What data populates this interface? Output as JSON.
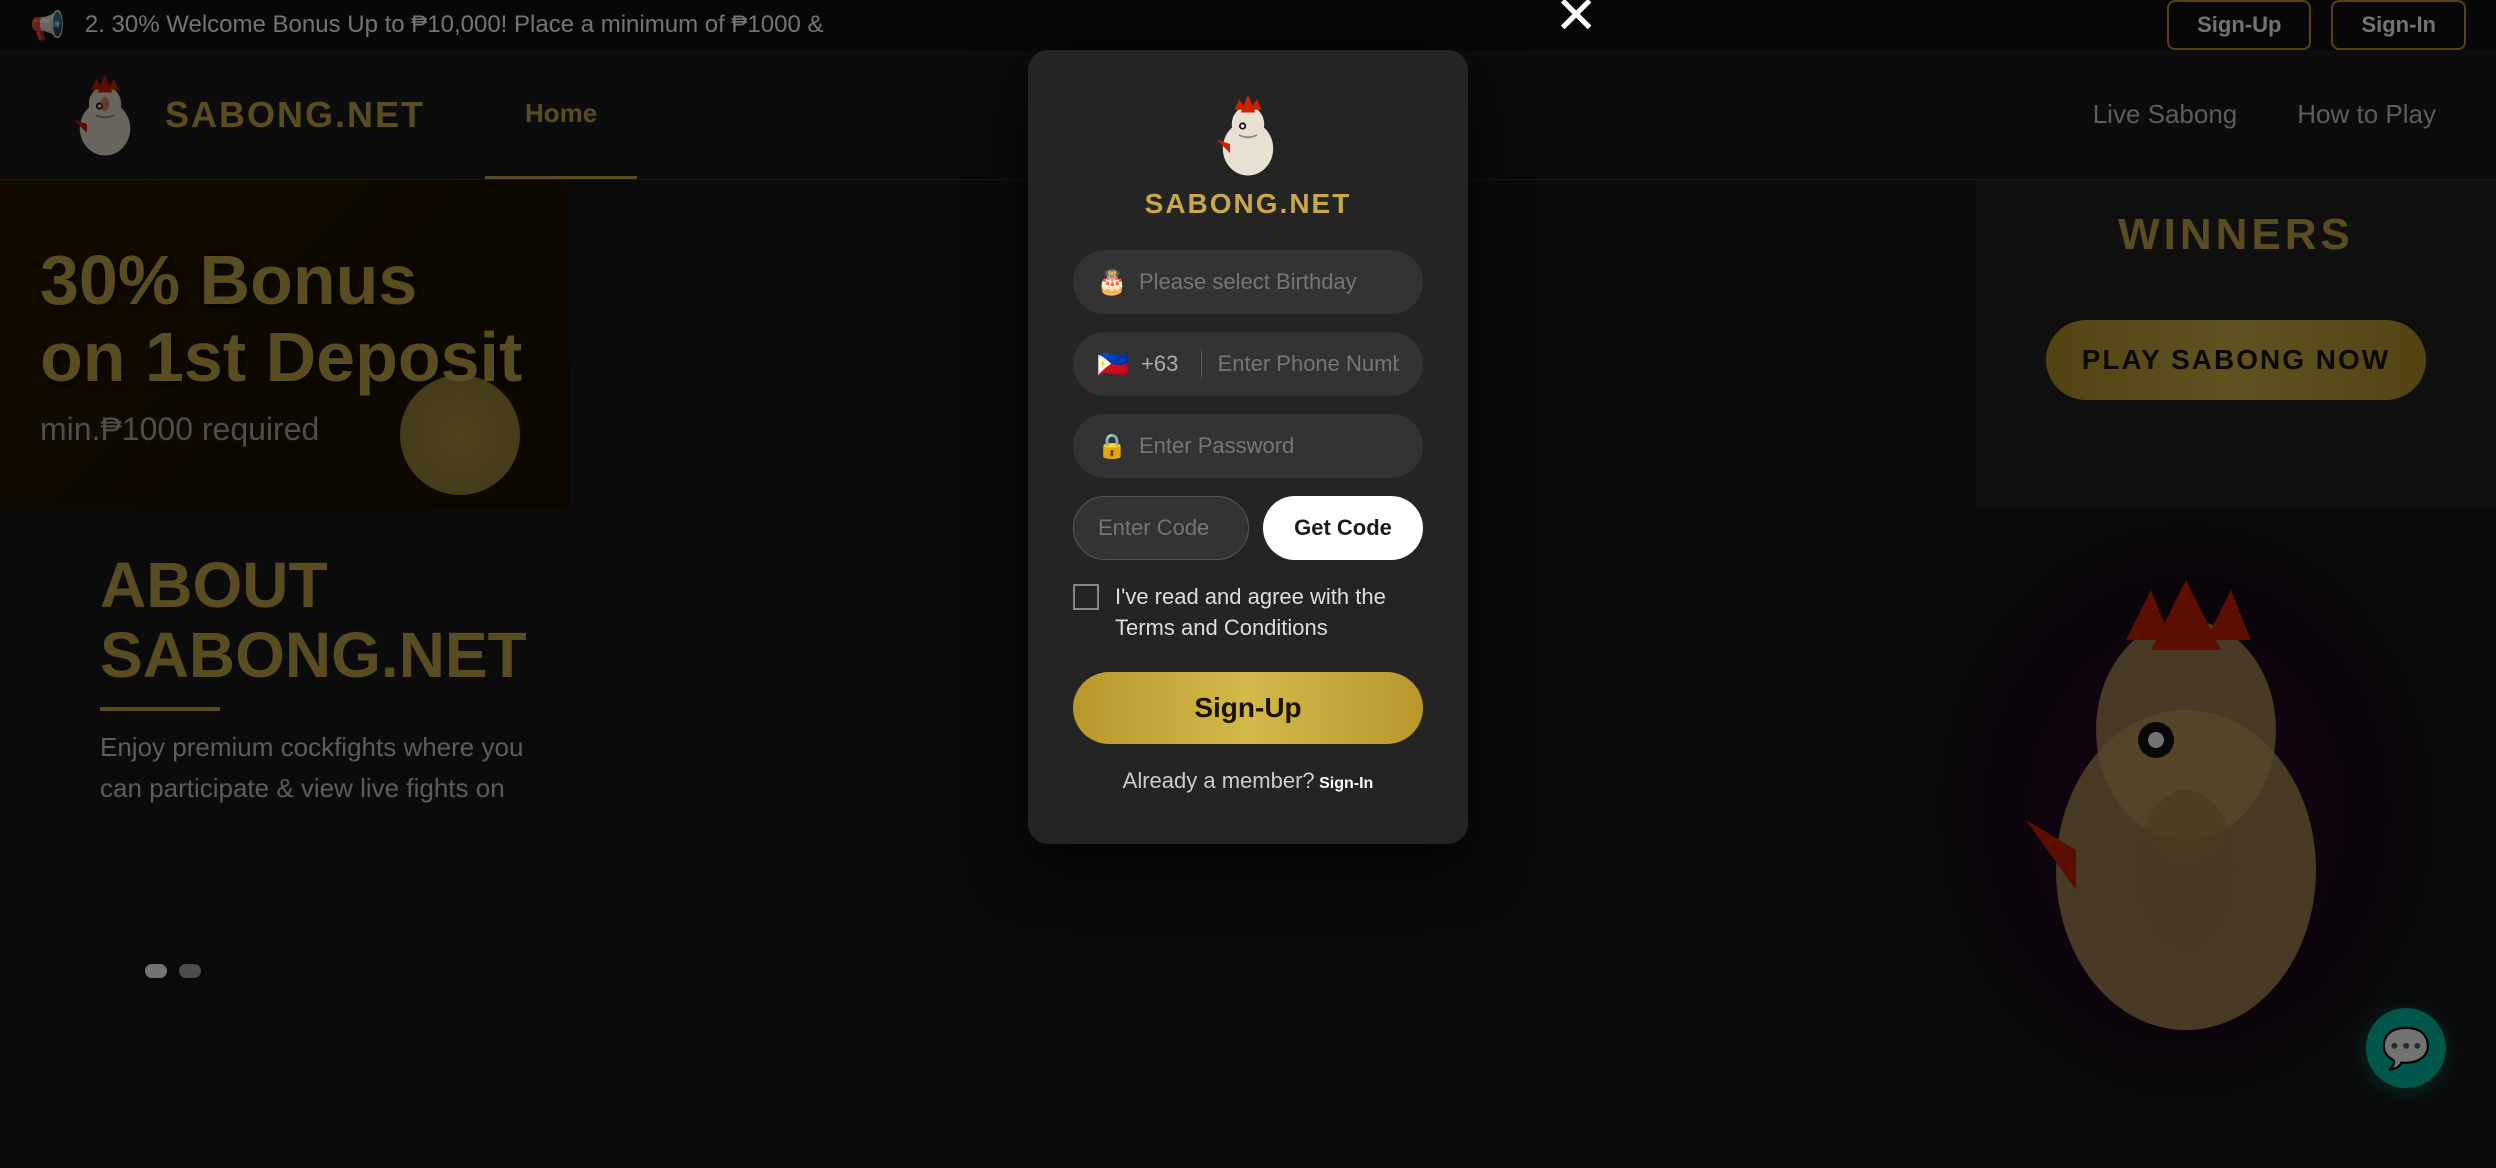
{
  "announcement": {
    "icon": "📢",
    "text": "2. 30% Welcome Bonus Up to ₱10,000! Place a minimum of ₱1000 &",
    "signup_label": "Sign-Up",
    "signin_label": "Sign-In"
  },
  "header": {
    "logo_text": "SABONG.NET",
    "nav": {
      "home": "Home",
      "live_sabong": "Live Sabong",
      "how_to_play": "How to Play"
    }
  },
  "hero": {
    "line1": "30% Bonus",
    "line2": "on 1st Deposit",
    "subtitle": "min.₱1000 required"
  },
  "winners": {
    "title": "WINNERS",
    "play_btn": "PLAY SABONG NOW"
  },
  "about": {
    "title": "ABOUT\nSABONG.NET",
    "text": "Enjoy premium cockfights where you\ncan participate & view live fights on"
  },
  "modal": {
    "brand": "SABONG.NET",
    "close": "✕",
    "birthday_placeholder": "Please select Birthday",
    "phone_code": "+63",
    "phone_placeholder": "Enter Phone Number",
    "password_placeholder": "Enter Password",
    "code_placeholder": "Enter Code",
    "get_code_label": "Get Code",
    "terms_text": "I've read and agree with the Terms and Conditions",
    "signup_label": "Sign-Up",
    "signin_text": "Already a member?",
    "signin_link": "Sign-In"
  },
  "chat": {
    "icon": "💬"
  }
}
